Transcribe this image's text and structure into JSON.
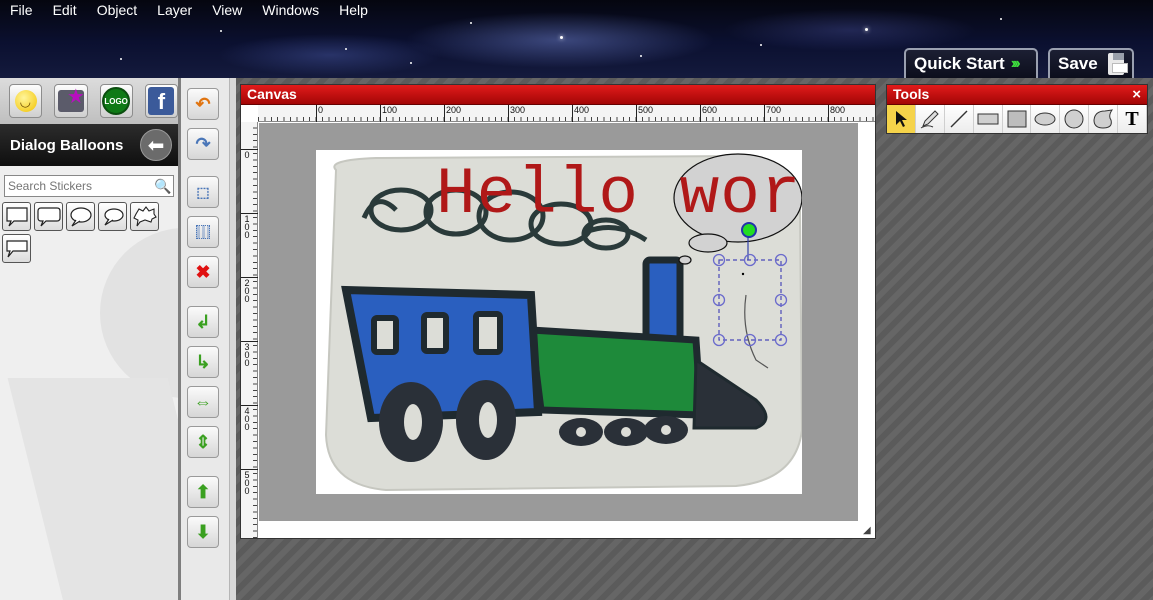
{
  "menu": [
    "File",
    "Edit",
    "Object",
    "Layer",
    "View",
    "Windows",
    "Help"
  ],
  "header_buttons": {
    "quick_start": "Quick Start",
    "save": "Save"
  },
  "left_panel": {
    "categories": [
      "smiley-icon",
      "photo-star-icon",
      "logo-badge-icon",
      "facebook-icon"
    ],
    "logo_badge_text": "LOGO",
    "facebook_letter": "f",
    "section_title": "Dialog Balloons",
    "search_placeholder": "Search Stickers",
    "balloon_count": 6
  },
  "vertical_toolbar": [
    "undo-icon",
    "redo-icon",
    "select-all-icon",
    "grid-icon",
    "delete-icon",
    "bring-forward-icon",
    "send-backward-icon",
    "flip-horizontal-icon",
    "flip-vertical-icon",
    "move-up-icon",
    "move-down-icon"
  ],
  "canvas_window": {
    "title": "Canvas",
    "ruler_x": [
      "0",
      "100",
      "200",
      "300",
      "400",
      "500",
      "600",
      "700",
      "800"
    ],
    "ruler_y": [
      "0",
      "100",
      "200",
      "300",
      "400",
      "500"
    ],
    "text_object": "Hello wor"
  },
  "tools_window": {
    "title": "Tools",
    "close": "×",
    "tools": [
      "pointer-tool",
      "pen-tool",
      "line-tool",
      "rectangle-tool",
      "filled-rectangle-tool",
      "ellipse-tool",
      "circle-tool",
      "freeform-shape-tool",
      "text-tool"
    ],
    "text_tool_glyph": "T"
  },
  "colors": {
    "title_bar_red": "#c80e0e",
    "text_red": "#b01818",
    "active_tool": "#f5d34a",
    "selection_handles": "#6a6acc",
    "rotate_handle": "#22dd22",
    "train_blue": "#2a5fbf",
    "train_green": "#1e8a3a"
  }
}
